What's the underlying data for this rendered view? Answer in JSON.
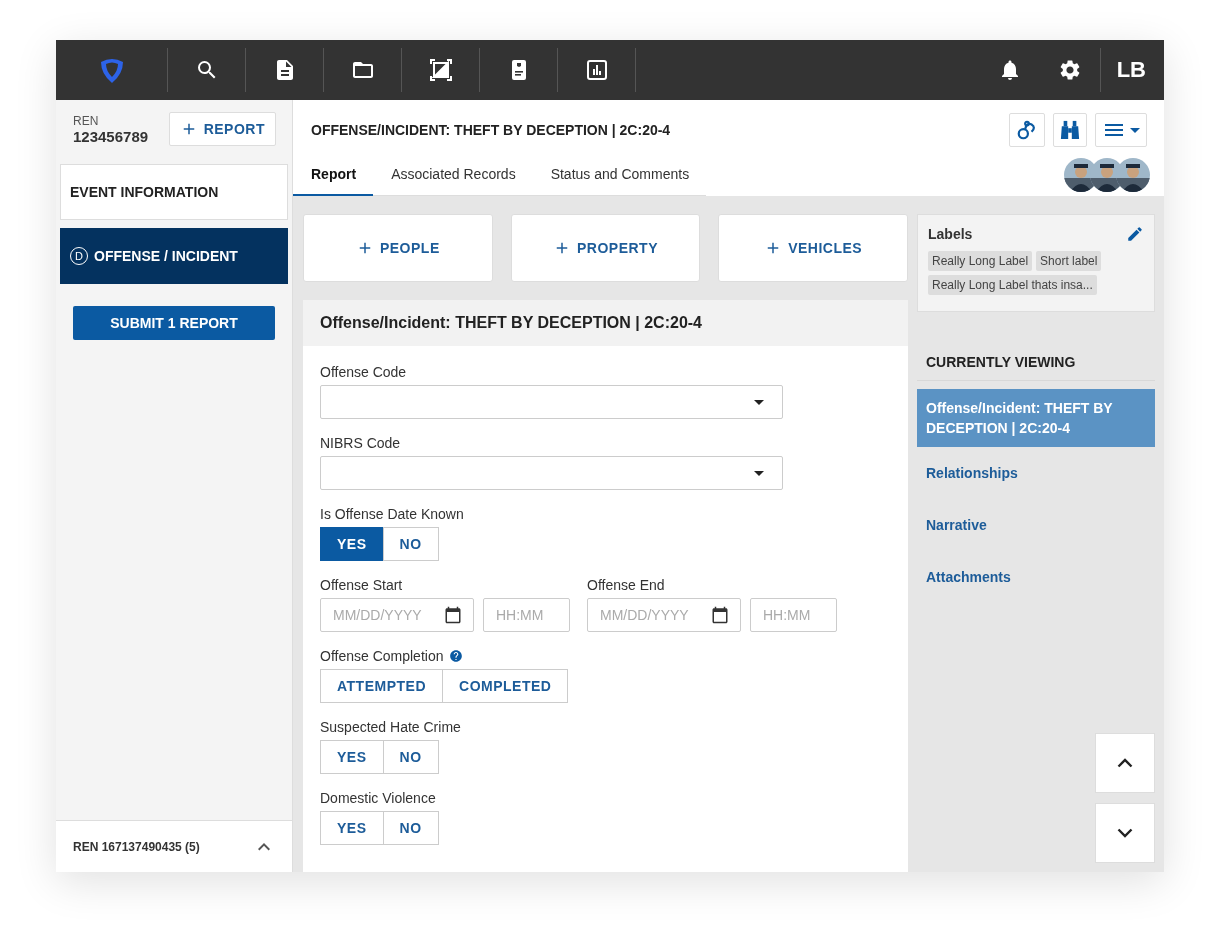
{
  "top_bar": {
    "user_initials": "LB"
  },
  "sidebar": {
    "ren_label": "REN",
    "ren_number": "123456789",
    "add_report_button": "REPORT",
    "items": [
      {
        "label": "EVENT INFORMATION",
        "selected": false
      },
      {
        "label": "OFFENSE / INCIDENT",
        "badge": "D",
        "selected": true
      }
    ],
    "submit_button": "SUBMIT 1 REPORT",
    "footer": "REN 167137490435 (5)"
  },
  "header": {
    "title": "OFFENSE/INCIDENT: THEFT BY DECEPTION | 2C:20-4",
    "tabs": [
      {
        "label": "Report",
        "selected": true
      },
      {
        "label": "Associated Records",
        "selected": false
      },
      {
        "label": "Status and Comments",
        "selected": false
      }
    ]
  },
  "add_buttons": [
    "PEOPLE",
    "PROPERTY",
    "VEHICLES"
  ],
  "form": {
    "title": "Offense/Incident: THEFT BY DECEPTION | 2C:20-4",
    "fields": [
      {
        "kind": "select",
        "label": "Offense Code"
      },
      {
        "kind": "select",
        "label": "NIBRS Code"
      },
      {
        "kind": "toggle",
        "label": "Is Offense Date Known",
        "help": false,
        "options": [
          {
            "label": "YES",
            "selected": true
          },
          {
            "label": "NO",
            "selected": false
          }
        ]
      },
      {
        "kind": "datetime_pair",
        "items": [
          {
            "label": "Offense Start",
            "date_placeholder": "MM/DD/YYYY",
            "time_placeholder": "HH:MM"
          },
          {
            "label": "Offense End",
            "date_placeholder": "MM/DD/YYYY",
            "time_placeholder": "HH:MM"
          }
        ]
      },
      {
        "kind": "toggle",
        "label": "Offense Completion",
        "help": true,
        "options": [
          {
            "label": "ATTEMPTED",
            "selected": false
          },
          {
            "label": "COMPLETED",
            "selected": false
          }
        ]
      },
      {
        "kind": "toggle",
        "label": "Suspected Hate Crime",
        "help": false,
        "options": [
          {
            "label": "YES",
            "selected": false
          },
          {
            "label": "NO",
            "selected": false
          }
        ]
      },
      {
        "kind": "toggle",
        "label": "Domestic Violence",
        "help": false,
        "options": [
          {
            "label": "YES",
            "selected": false
          },
          {
            "label": "NO",
            "selected": false
          }
        ]
      }
    ]
  },
  "labels_panel": {
    "title": "Labels",
    "tags": [
      "Really Long Label",
      "Short label",
      "Really Long Label thats insa..."
    ]
  },
  "currently_viewing": {
    "heading": "CURRENTLY VIEWING",
    "items": [
      {
        "label": "Offense/Incident: THEFT BY DECEPTION | 2C:20-4",
        "selected": true
      },
      {
        "label": "Relationships",
        "selected": false
      },
      {
        "label": "Narrative",
        "selected": false
      },
      {
        "label": "Attachments",
        "selected": false
      }
    ]
  }
}
